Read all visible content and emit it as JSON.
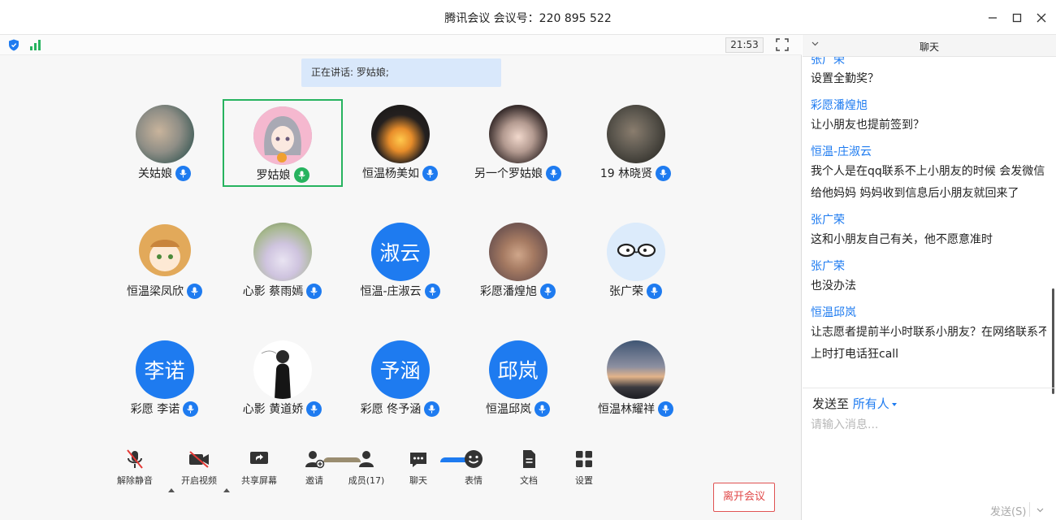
{
  "window": {
    "title": "腾讯会议  会议号：220 895 522",
    "controls": [
      "minimize-icon",
      "maximize-icon",
      "close-icon"
    ]
  },
  "meeting": {
    "clock": "21:53",
    "speaking": "正在讲话: 罗姑娘;"
  },
  "participants": [
    {
      "name": "关姑娘",
      "avatar": "photo",
      "mic": "on"
    },
    {
      "name": "罗姑娘",
      "avatar": "photo",
      "mic": "speaking",
      "active": true
    },
    {
      "name": "恒温杨美如",
      "avatar": "photo",
      "mic": "on"
    },
    {
      "name": "另一个罗姑娘",
      "avatar": "photo",
      "mic": "on"
    },
    {
      "name": "19 林晓贤",
      "avatar": "photo",
      "mic": "on"
    },
    {
      "name": "恒温梁凤欣",
      "avatar": "photo",
      "mic": "on"
    },
    {
      "name": "心影 蔡雨嫣",
      "avatar": "photo",
      "mic": "on"
    },
    {
      "name": "恒温-庄淑云",
      "avatar": "text",
      "avatar_text": "淑云",
      "mic": "on"
    },
    {
      "name": "彩愿潘煌旭",
      "avatar": "photo",
      "mic": "on"
    },
    {
      "name": "张广荣",
      "avatar": "photo",
      "mic": "on"
    },
    {
      "name": "彩愿 李诺",
      "avatar": "text",
      "avatar_text": "李诺",
      "mic": "on"
    },
    {
      "name": "心影 黄道娇",
      "avatar": "photo",
      "mic": "on"
    },
    {
      "name": "彩愿 佟予涵",
      "avatar": "text",
      "avatar_text": "予涵",
      "mic": "on"
    },
    {
      "name": "恒温邱岚",
      "avatar": "text",
      "avatar_text": "邱岚",
      "mic": "on"
    },
    {
      "name": "恒温林耀祥",
      "avatar": "photo",
      "mic": "on"
    }
  ],
  "toolbar": {
    "unmute": "解除静音",
    "start_video": "开启视频",
    "share_screen": "共享屏幕",
    "invite": "邀请",
    "members": "成员(17)",
    "chat": "聊天",
    "reactions": "表情",
    "docs": "文档",
    "settings": "设置",
    "leave": "离开会议"
  },
  "chat": {
    "title": "聊天",
    "messages": [
      {
        "sender": "张广荣",
        "text": "设置全勤奖？"
      },
      {
        "sender": "彩愿潘煌旭",
        "text": "让小朋友也提前签到？"
      },
      {
        "sender": "恒温-庄淑云",
        "text": "我个人是在qq联系不上小朋友的时候 会发微信给他妈妈 妈妈收到信息后小朋友就回来了"
      },
      {
        "sender": "张广荣",
        "text": "这和小朋友自己有关，他不愿意准时"
      },
      {
        "sender": "张广荣",
        "text": "也没办法"
      },
      {
        "sender": "恒温邱岚",
        "text": "让志愿者提前半小时联系小朋友？在网络联系不上时打电话狂call"
      }
    ],
    "send_to_label": "发送至",
    "send_to_target": "所有人",
    "input_placeholder": "请输入消息...",
    "send_button": "发送(S)"
  },
  "colors": {
    "accent": "#1e7bf0",
    "speaking_green": "#27b35f",
    "leave_red": "#e04848"
  }
}
